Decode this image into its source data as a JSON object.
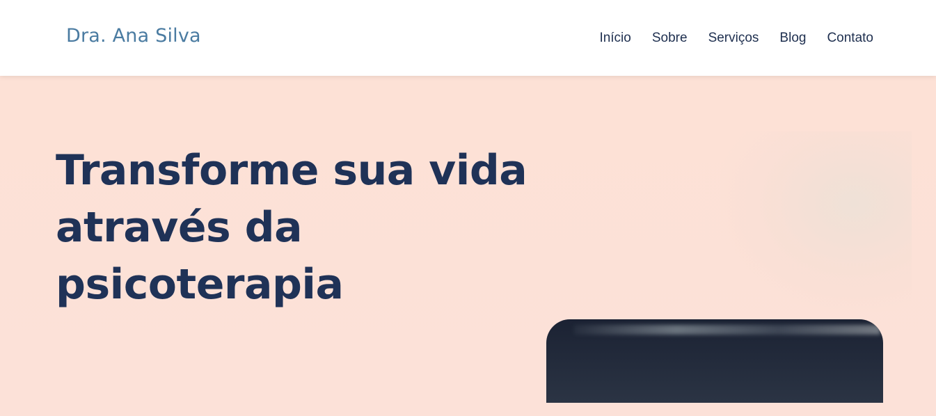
{
  "brand": {
    "name": "Dra. Ana Silva",
    "color": "#4a7ba1"
  },
  "nav": {
    "items": [
      {
        "label": "Início"
      },
      {
        "label": "Sobre"
      },
      {
        "label": "Serviços"
      },
      {
        "label": "Blog"
      },
      {
        "label": "Contato"
      }
    ]
  },
  "hero": {
    "title": "Transforme sua vida através da psicoterapia",
    "subtitle": "",
    "background_color": "#fde1d6",
    "title_color": "#1f3257"
  }
}
